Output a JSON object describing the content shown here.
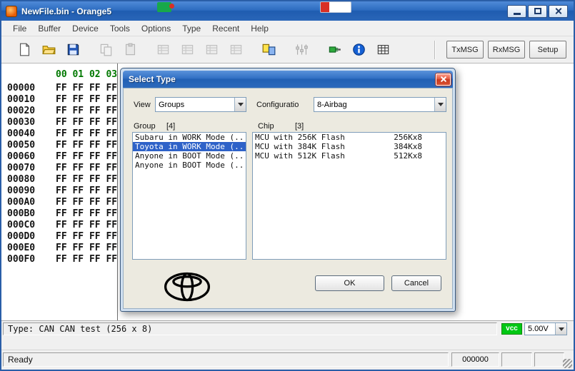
{
  "window": {
    "title": "NewFile.bin - Orange5"
  },
  "menu": {
    "items": [
      {
        "label": "File",
        "name": "menu-file"
      },
      {
        "label": "Buffer",
        "name": "menu-buffer"
      },
      {
        "label": "Device",
        "name": "menu-device"
      },
      {
        "label": "Tools",
        "name": "menu-tools"
      },
      {
        "label": "Options",
        "name": "menu-options"
      },
      {
        "label": "Type",
        "name": "menu-type"
      },
      {
        "label": "Recent",
        "name": "menu-recent"
      },
      {
        "label": "Help",
        "name": "menu-help"
      }
    ]
  },
  "toolbar": {
    "icons": [
      "new-file-icon",
      "open-file-icon",
      "save-file-icon",
      "copy-icon",
      "paste-icon",
      "buffer-1-icon",
      "buffer-2-icon",
      "buffer-3-icon",
      "buffer-4-icon",
      "swap-buffers-icon",
      "signal-levels-icon",
      "connect-device-icon",
      "info-icon",
      "checksum-icon"
    ],
    "buttons": [
      {
        "label": "TxMSG",
        "name": "txmsg-button"
      },
      {
        "label": "RxMSG",
        "name": "rxmsg-button"
      },
      {
        "label": "Setup",
        "name": "setup-button"
      }
    ]
  },
  "hex_editor": {
    "column_header": "00 01 02 03",
    "rows": [
      {
        "addr": "00000",
        "values": "FF FF FF FF"
      },
      {
        "addr": "00010",
        "values": "FF FF FF FF"
      },
      {
        "addr": "00020",
        "values": "FF FF FF FF"
      },
      {
        "addr": "00030",
        "values": "FF FF FF FF"
      },
      {
        "addr": "00040",
        "values": "FF FF FF FF"
      },
      {
        "addr": "00050",
        "values": "FF FF FF FF"
      },
      {
        "addr": "00060",
        "values": "FF FF FF FF"
      },
      {
        "addr": "00070",
        "values": "FF FF FF FF"
      },
      {
        "addr": "00080",
        "values": "FF FF FF FF"
      },
      {
        "addr": "00090",
        "values": "FF FF FF FF"
      },
      {
        "addr": "000A0",
        "values": "FF FF FF FF"
      },
      {
        "addr": "000B0",
        "values": "FF FF FF FF"
      },
      {
        "addr": "000C0",
        "values": "FF FF FF FF"
      },
      {
        "addr": "000D0",
        "values": "FF FF FF FF"
      },
      {
        "addr": "000E0",
        "values": "FF FF FF FF"
      },
      {
        "addr": "000F0",
        "values": "FF FF FF FF"
      }
    ]
  },
  "dialog": {
    "title": "Select Type",
    "view_label": "View",
    "view_value": "Groups",
    "config_label": "Configuratio",
    "config_value": "8-Airbag",
    "group_label": "Group",
    "group_count": "[4]",
    "chip_label": "Chip",
    "chip_count": "[3]",
    "groups": [
      {
        "label": "Subaru in WORK Mode (...",
        "selected": false
      },
      {
        "label": "Toyota in WORK Mode (...",
        "selected": true
      },
      {
        "label": "Anyone in BOOT Mode (...",
        "selected": false
      },
      {
        "label": "Anyone in BOOT Mode (...",
        "selected": false
      }
    ],
    "chips": [
      {
        "name": "MCU with 256K Flash",
        "size": "256Kx8"
      },
      {
        "name": "MCU with 384K Flash",
        "size": "384Kx8"
      },
      {
        "name": "MCU with 512K Flash",
        "size": "512Kx8"
      }
    ],
    "ok_label": "OK",
    "cancel_label": "Cancel"
  },
  "status": {
    "type_text": "Type: CAN CAN test (256 x 8)",
    "vcc_label": "vcc",
    "voltage": "5.00V",
    "ready": "Ready",
    "counter": "000000"
  },
  "colors": {
    "titlebar_blue": "#2d6cc0",
    "selection_blue": "#2e62c8",
    "vcc_green": "#00c814",
    "hex_header_green": "#007800"
  }
}
